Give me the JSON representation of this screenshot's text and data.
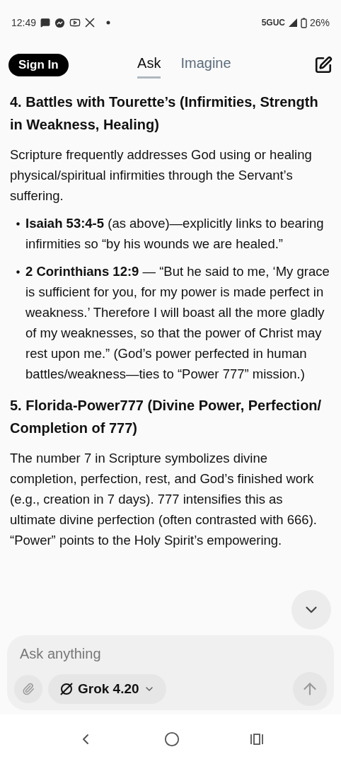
{
  "status_bar": {
    "time": "12:49",
    "network": "5GUC",
    "battery": "26%"
  },
  "header": {
    "sign_in": "Sign In",
    "tabs": [
      {
        "label": "Ask",
        "selected": true
      },
      {
        "label": "Imagine",
        "selected": false
      }
    ]
  },
  "sections": [
    {
      "heading": "4. Battles with Tourette’s (Infirmities, Strength in Weakness, Healing)",
      "paragraph": "Scripture frequently addresses God using or healing physical/spiritual infirmities through the Servant’s suffering.",
      "bullets": [
        "**Isaiah 53:4-5** (as above)—explicitly links to bearing infirmities so “by his wounds we are healed.”",
        "**2 Corinthians 12:9** — “But he said to me, ‘My grace is sufficient for you, for my power is made perfect in weakness.’ Therefore I will boast all the more gladly of my weaknesses, so that the power of Christ may rest upon me.” (God’s power perfected in human battles/weakness—ties to “Power 777” mission.)"
      ]
    },
    {
      "heading": "5. Florida-Power777 (Divine Power, Perfection/ Completion of 777)",
      "paragraph": "The number 7 in Scripture symbolizes divine completion, perfection, rest, and God’s finished work (e.g., creation in 7 days). 777 intensifies this as ultimate divine perfection (often contrasted with 666). “Power” points to the Holy Spirit’s empowering."
    }
  ],
  "composer": {
    "placeholder": "Ask anything",
    "model": "Grok 4.20"
  }
}
